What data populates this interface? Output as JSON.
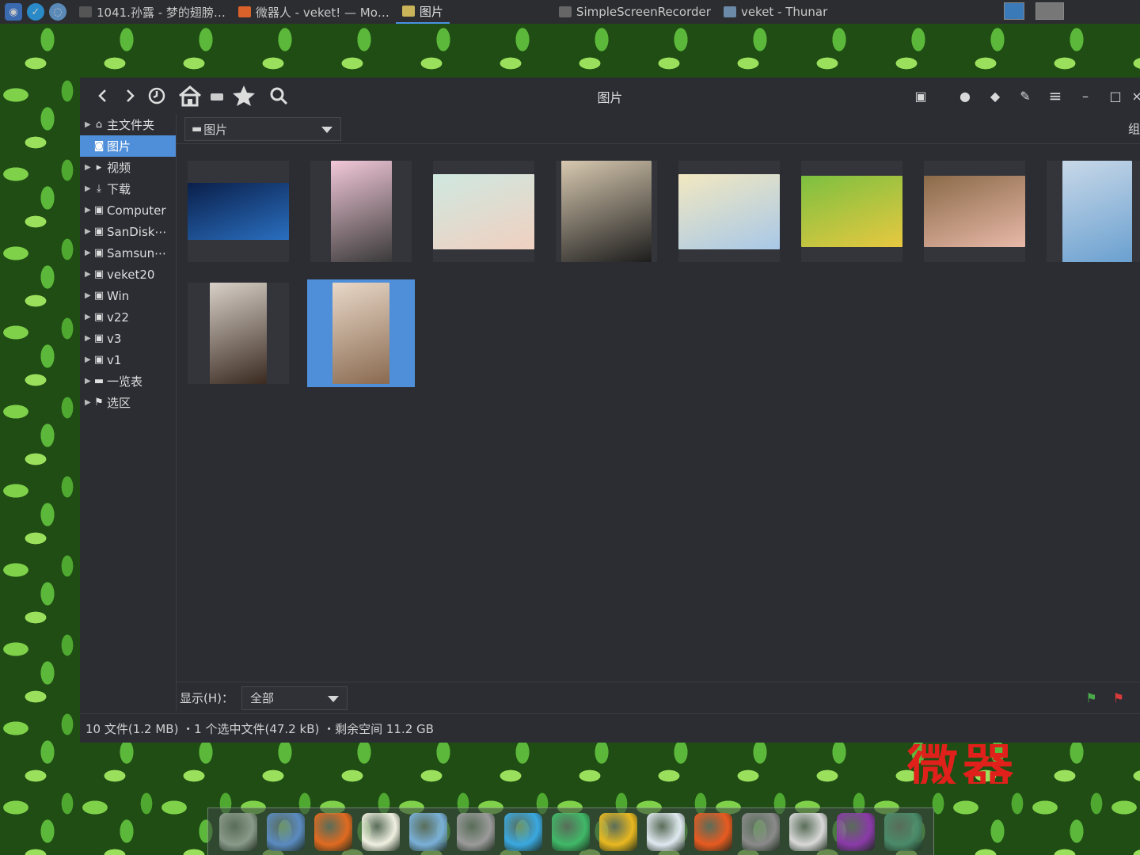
{
  "panel": {
    "tasks": [
      {
        "label": "1041.孙露 - 梦的翅膀…",
        "icon": "music-player-icon",
        "color": "#555"
      },
      {
        "label": "微器人 - veket! — Mo…",
        "icon": "firefox-icon",
        "color": "#d9622b"
      },
      {
        "label": "图片",
        "icon": "image-viewer-icon",
        "color": "#c9b45a",
        "active": true
      },
      {
        "label": "SimpleScreenRecorder",
        "icon": "window-icon",
        "color": "#666"
      },
      {
        "label": "veket - Thunar",
        "icon": "folder-icon",
        "color": "#6a8aa8"
      }
    ]
  },
  "window": {
    "title": "图片",
    "path_label": "图片",
    "group_label": "组",
    "sidebar": [
      {
        "label": "主文件夹",
        "icon": "home-icon",
        "glyph": "⌂",
        "arrow": true
      },
      {
        "label": "图片",
        "icon": "camera-icon",
        "glyph": "◙",
        "selected": true
      },
      {
        "label": "视频",
        "icon": "video-icon",
        "glyph": "▸",
        "arrow": true
      },
      {
        "label": "下载",
        "icon": "download-icon",
        "glyph": "⤓",
        "arrow": true
      },
      {
        "label": "Computer",
        "icon": "drive-icon",
        "glyph": "▣",
        "arrow": true
      },
      {
        "label": "SanDisk⋯",
        "icon": "usb-drive-icon",
        "glyph": "▣",
        "arrow": true
      },
      {
        "label": "Samsun⋯",
        "icon": "usb-drive-icon",
        "glyph": "▣",
        "arrow": true
      },
      {
        "label": "veket20",
        "icon": "drive-icon",
        "glyph": "▣",
        "arrow": true
      },
      {
        "label": "Win",
        "icon": "drive-icon",
        "glyph": "▣",
        "arrow": true
      },
      {
        "label": "v22",
        "icon": "chip-icon",
        "glyph": "▣",
        "arrow": true
      },
      {
        "label": "v3",
        "icon": "chip-icon",
        "glyph": "▣",
        "arrow": true
      },
      {
        "label": "v1",
        "icon": "chip-icon",
        "glyph": "▣",
        "arrow": true
      },
      {
        "label": "一览表",
        "icon": "list-drive-icon",
        "glyph": "▬",
        "arrow": true
      },
      {
        "label": "选区",
        "icon": "flag-icon",
        "glyph": "⚑",
        "arrow": true
      }
    ],
    "show_label": "显示(H)：",
    "show_value": "全部",
    "status": "10 文件(1.2 MB) ・1 个选中文件(47.2 kB) ・剩余空间 11.2 GB",
    "thumbnails": [
      {
        "name": "abstract-blue",
        "colors": [
          "#0a1f4a",
          "#2a6fc0"
        ]
      },
      {
        "name": "girl-pink",
        "colors": [
          "#f2c8d8",
          "#3a3a3a"
        ]
      },
      {
        "name": "girl-painting",
        "colors": [
          "#cfe8e0",
          "#f0d0c0"
        ]
      },
      {
        "name": "girl-sweater",
        "colors": [
          "#d8c9b0",
          "#1d1d1d"
        ]
      },
      {
        "name": "girl-wings",
        "colors": [
          "#f2e8c0",
          "#a8c8e8"
        ]
      },
      {
        "name": "girl-garden",
        "colors": [
          "#7cc040",
          "#e8c840"
        ]
      },
      {
        "name": "girl-traditional",
        "colors": [
          "#8a6a48",
          "#e8b8a8"
        ]
      },
      {
        "name": "girl-blue",
        "colors": [
          "#c8d8e8",
          "#6aa0d0"
        ]
      },
      {
        "name": "girl-longhair",
        "colors": [
          "#d8d0c8",
          "#3a2a20"
        ]
      },
      {
        "name": "girl-sitting",
        "colors": [
          "#e8d8c8",
          "#8a6a50"
        ],
        "selected": true
      }
    ]
  },
  "desktop": {
    "overlay_text": "微器"
  },
  "dock": [
    {
      "icon": "drive-icon",
      "color": "#8a9a8a"
    },
    {
      "icon": "monitor-icon",
      "color": "#5a8ac0"
    },
    {
      "icon": "firefox-icon",
      "color": "#e06a20"
    },
    {
      "icon": "text-editor-icon",
      "color": "#f0f0e0"
    },
    {
      "icon": "image-editor-icon",
      "color": "#7ab0d8"
    },
    {
      "icon": "audio-icon",
      "color": "#9a9a9a"
    },
    {
      "icon": "atom-icon",
      "color": "#3aa8e0"
    },
    {
      "icon": "media-player-icon",
      "color": "#40b868"
    },
    {
      "icon": "contacts-icon",
      "color": "#e8b820"
    },
    {
      "icon": "charts-icon",
      "color": "#e0e8f0"
    },
    {
      "icon": "rocket-icon",
      "color": "#e85a20"
    },
    {
      "icon": "printer-icon",
      "color": "#8a8a8a"
    },
    {
      "icon": "settings-sun-icon",
      "color": "#d8d8d8"
    },
    {
      "icon": "firefox-icon",
      "color": "#8a3aa8"
    },
    {
      "icon": "globe-icon",
      "color": "#4a8a6a"
    }
  ]
}
